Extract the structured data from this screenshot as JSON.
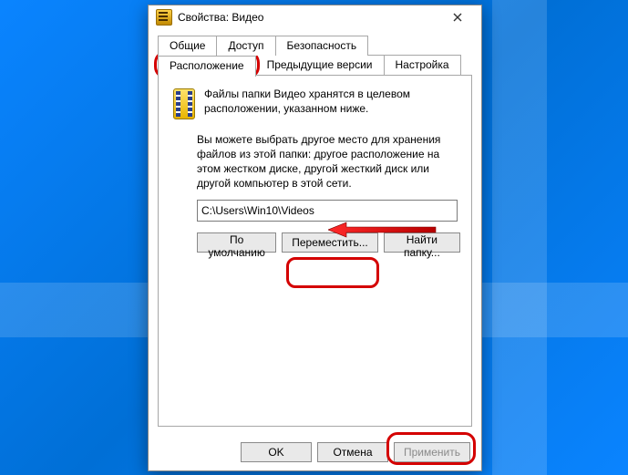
{
  "window": {
    "title": "Свойства: Видео"
  },
  "tabs": {
    "row1": [
      "Общие",
      "Доступ",
      "Безопасность"
    ],
    "row2": [
      "Расположение",
      "Предыдущие версии",
      "Настройка"
    ],
    "active": "Расположение"
  },
  "panel": {
    "desc": "Файлы папки Видео хранятся в целевом расположении, указанном ниже.",
    "info": "Вы можете выбрать другое место для хранения файлов из этой папки: другое расположение на этом жестком диске, другой жесткий диск или другой компьютер в этой сети.",
    "path": "C:\\Users\\Win10\\Videos",
    "buttons": {
      "restore": "По умолчанию",
      "move": "Переместить...",
      "find": "Найти папку..."
    }
  },
  "footer": {
    "ok": "OK",
    "cancel": "Отмена",
    "apply": "Применить"
  }
}
